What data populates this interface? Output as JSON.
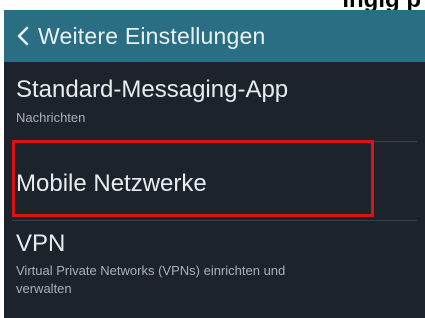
{
  "top_strip": {
    "text": "ingig p"
  },
  "header": {
    "back_icon": "chevron-left-icon",
    "title": "Weitere Einstellungen"
  },
  "settings": [
    {
      "title": "Standard-Messaging-App",
      "subtitle": "Nachrichten"
    },
    {
      "title": "Mobile Netzwerke",
      "subtitle": ""
    },
    {
      "title": "VPN",
      "subtitle_line1": "Virtual Private Networks (VPNs) einrichten und",
      "subtitle_line2": "verwalten"
    }
  ],
  "colors": {
    "header_bg": "#2a6e83",
    "screen_bg": "#1c232b",
    "highlight": "#d81416"
  }
}
